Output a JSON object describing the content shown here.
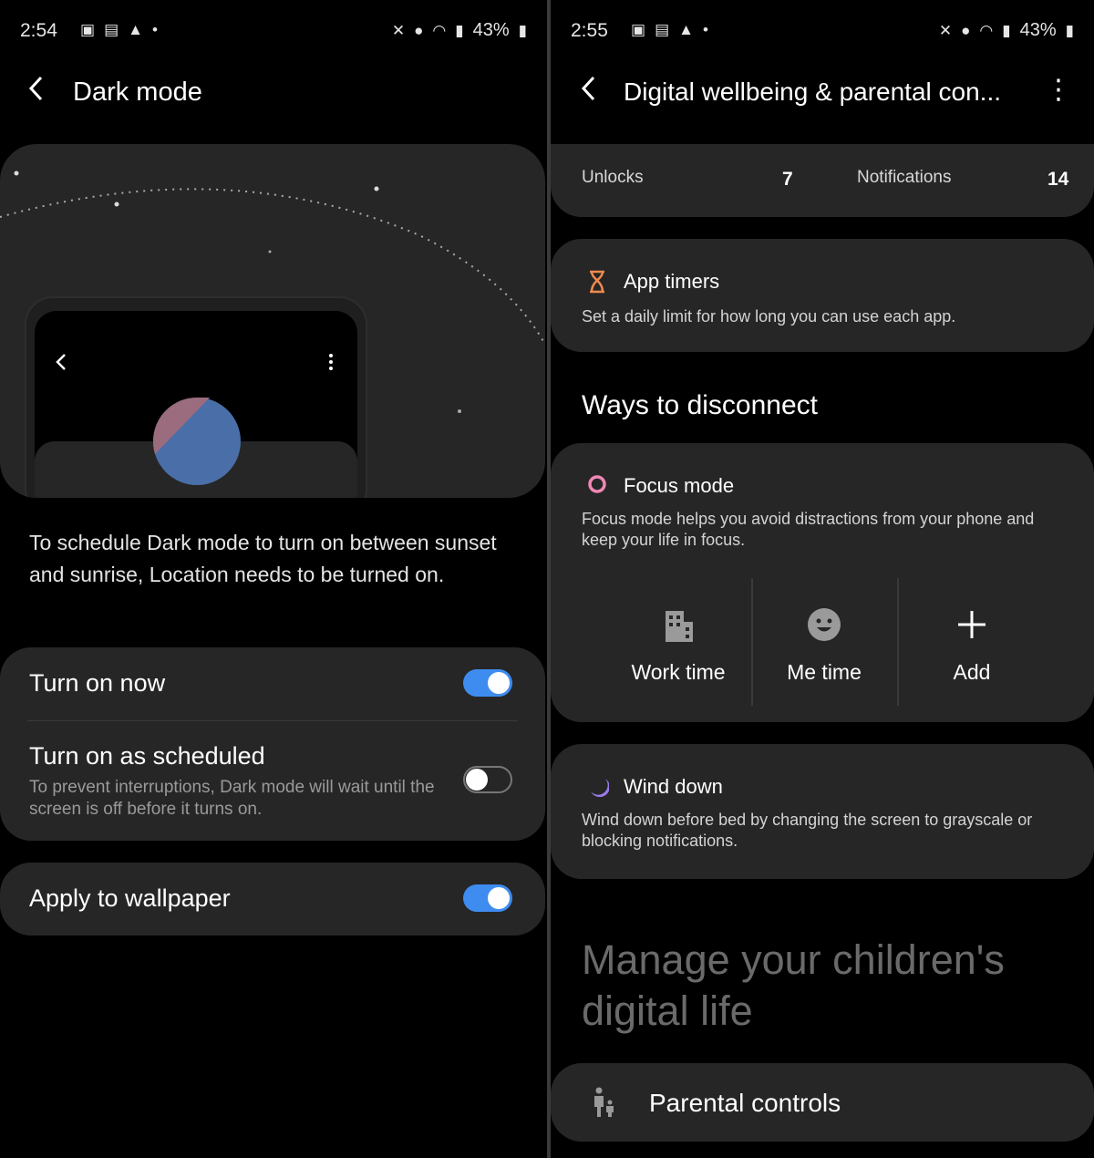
{
  "left": {
    "status": {
      "time": "2:54",
      "battery": "43%"
    },
    "title": "Dark mode",
    "info": "To schedule Dark mode to turn on between sunset and sunrise, Location needs to be turned on.",
    "turn_on_now": {
      "label": "Turn on now",
      "enabled": true
    },
    "scheduled": {
      "label": "Turn on as scheduled",
      "desc": "To prevent interruptions, Dark mode will wait until the screen is off before it turns on.",
      "enabled": false
    },
    "wallpaper": {
      "label": "Apply to wallpaper",
      "enabled": true
    }
  },
  "right": {
    "status": {
      "time": "2:55",
      "battery": "43%"
    },
    "title": "Digital wellbeing & parental con...",
    "stats": {
      "unlocks_label": "Unlocks",
      "unlocks": "7",
      "notifications_label": "Notifications",
      "notifications": "14"
    },
    "app_timers": {
      "title": "App timers",
      "desc": "Set a daily limit for how long you can use each app."
    },
    "section": "Ways to disconnect",
    "focus": {
      "title": "Focus mode",
      "desc": "Focus mode helps you avoid distractions from your phone and keep your life in focus.",
      "modes": [
        "Work time",
        "Me time",
        "Add"
      ]
    },
    "wind_down": {
      "title": "Wind down",
      "desc": "Wind down before bed by changing the screen to grayscale or blocking notifications."
    },
    "children_heading": "Manage your children's digital life",
    "parental": {
      "label": "Parental controls"
    }
  },
  "colors": {
    "accent": "#3e8cf0",
    "card": "#262626",
    "moon": "#f5c400"
  }
}
